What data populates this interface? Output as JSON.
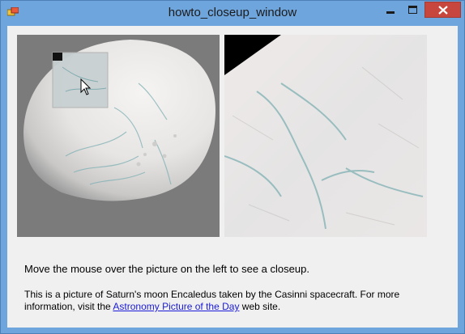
{
  "window": {
    "title": "howto_closeup_window",
    "controls": {
      "minimize": "minimize-icon",
      "maximize": "maximize-icon",
      "close": "close-icon"
    }
  },
  "instructions": "Move the mouse over the picture on the left to see a closeup.",
  "description": {
    "before_link": "This is a picture of Saturn's moon Encaledus taken by the Casinni spacecraft. For more information, visit the ",
    "link_text": "Astronomy Picture of the Day",
    "after_link": " web site."
  },
  "colors": {
    "titlebar": "#6fa5dd",
    "client_background": "#f0f0f0",
    "close_button": "#c7463d",
    "link": "#1a1ad8"
  }
}
